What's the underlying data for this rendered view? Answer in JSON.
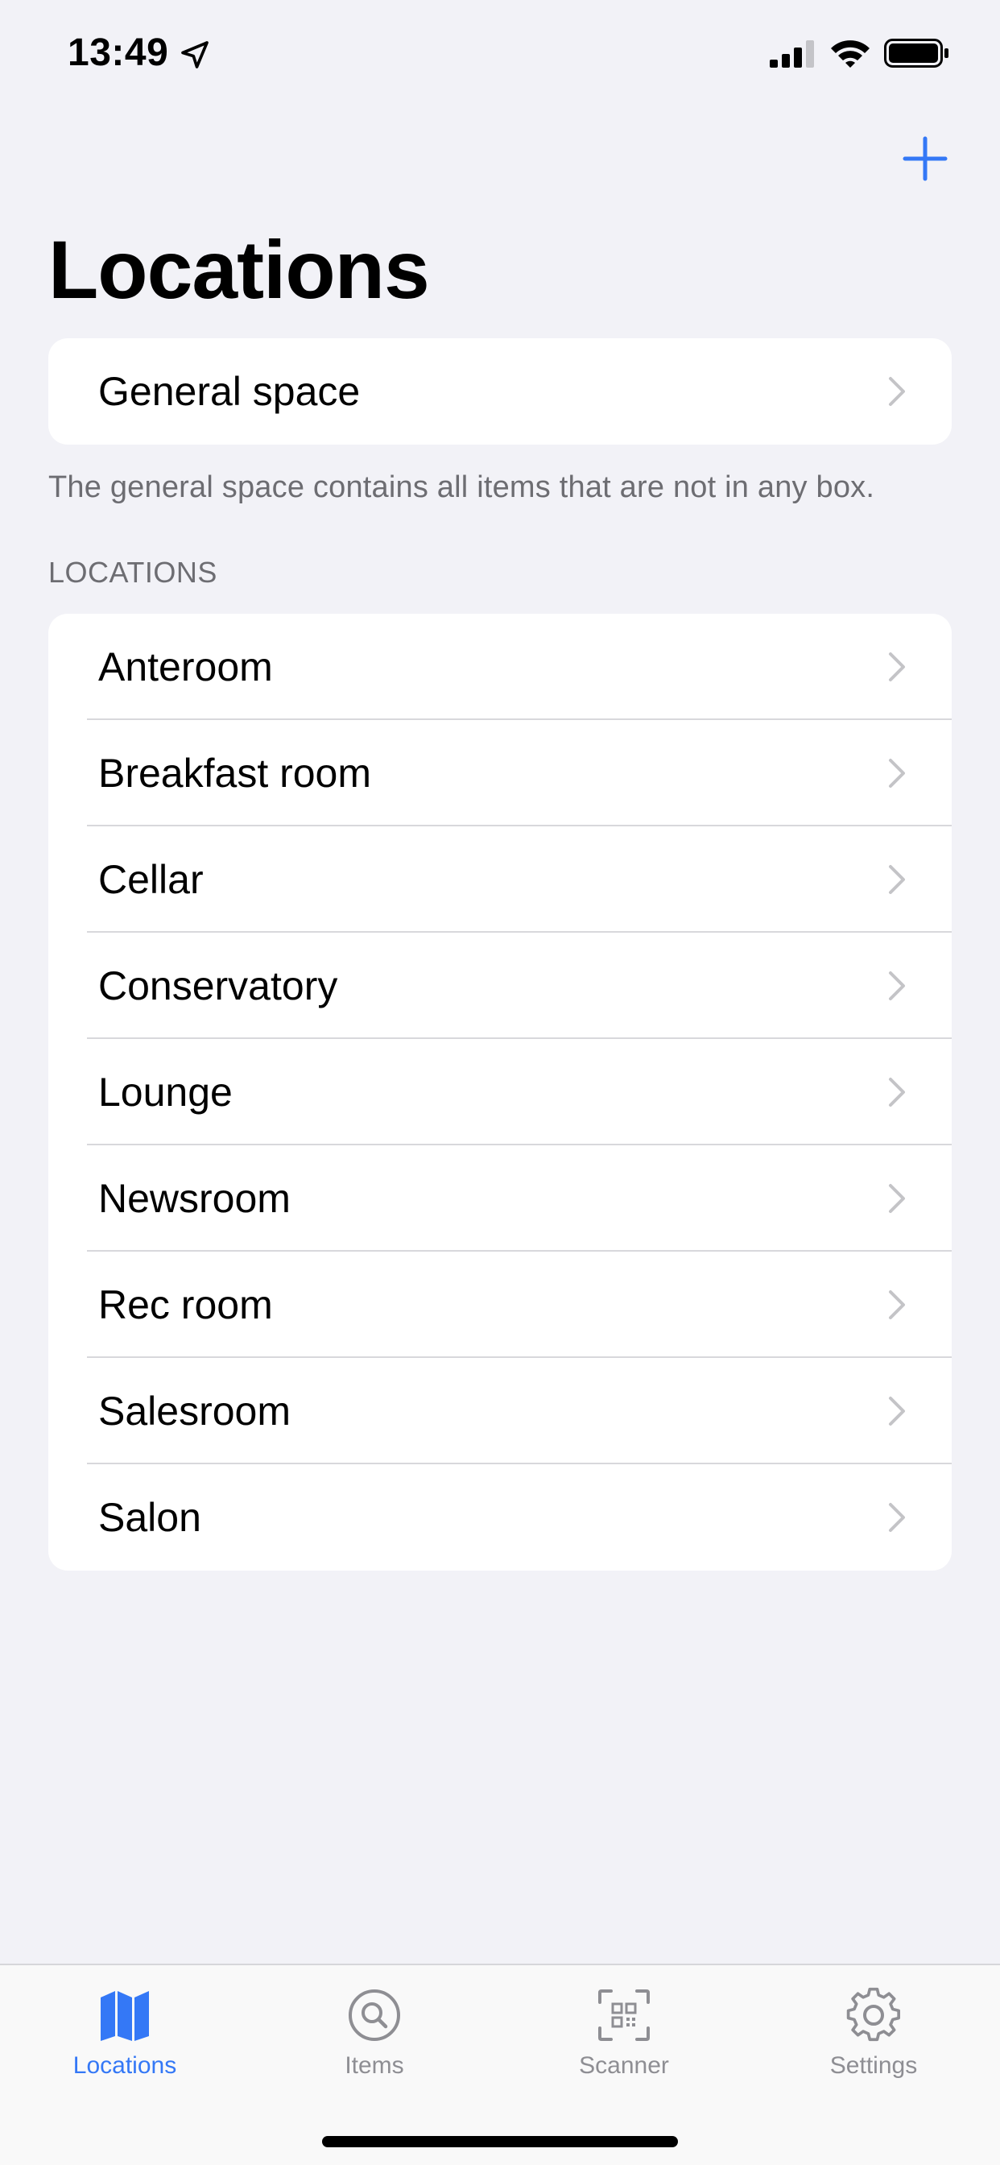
{
  "status_bar": {
    "time": "13:49"
  },
  "colors": {
    "accent": "#3478f6",
    "background": "#f2f2f7",
    "secondary_text": "#6d6d72",
    "tab_inactive": "#8e8e93"
  },
  "header": {
    "title": "Locations"
  },
  "general_space": {
    "label": "General space",
    "footer": "The general space contains all items that are not in any box."
  },
  "locations_section": {
    "header": "LOCATIONS",
    "items": [
      {
        "label": "Anteroom"
      },
      {
        "label": "Breakfast room"
      },
      {
        "label": "Cellar"
      },
      {
        "label": "Conservatory"
      },
      {
        "label": "Lounge"
      },
      {
        "label": "Newsroom"
      },
      {
        "label": "Rec room"
      },
      {
        "label": "Salesroom"
      },
      {
        "label": "Salon"
      }
    ]
  },
  "tab_bar": {
    "tabs": [
      {
        "label": "Locations",
        "icon": "map-icon",
        "active": true
      },
      {
        "label": "Items",
        "icon": "magnifying-glass-icon",
        "active": false
      },
      {
        "label": "Scanner",
        "icon": "qr-viewfinder-icon",
        "active": false
      },
      {
        "label": "Settings",
        "icon": "gear-icon",
        "active": false
      }
    ]
  }
}
